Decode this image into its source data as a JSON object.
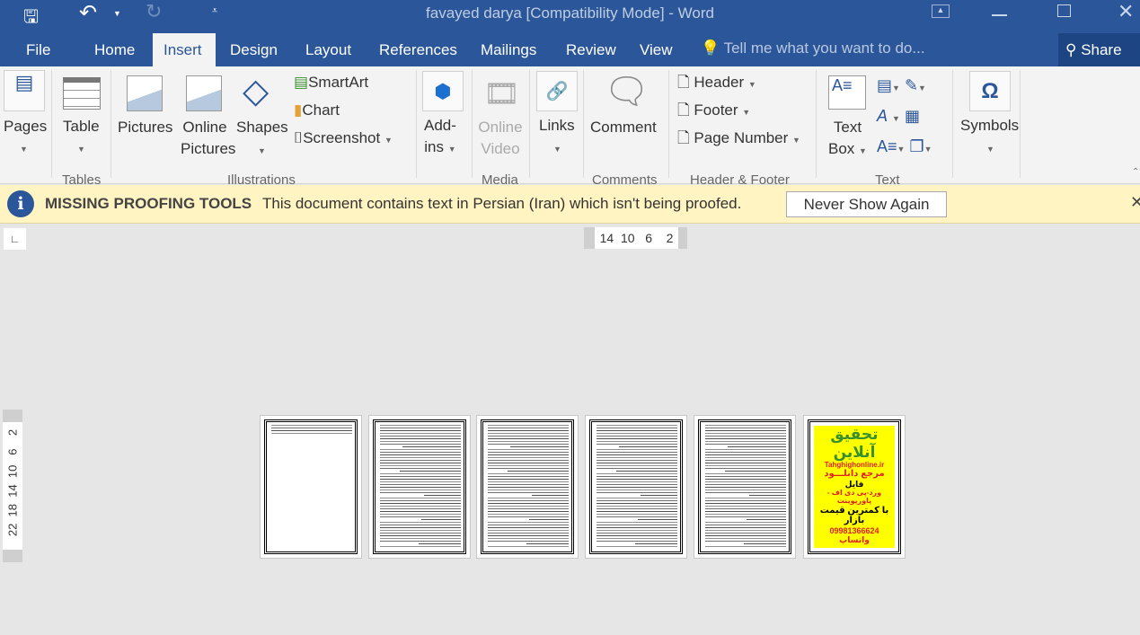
{
  "window": {
    "title": "favayed darya [Compatibility Mode] - Word"
  },
  "tabs": [
    {
      "label": "File"
    },
    {
      "label": "Home"
    },
    {
      "label": "Insert",
      "active": true
    },
    {
      "label": "Design"
    },
    {
      "label": "Layout"
    },
    {
      "label": "References"
    },
    {
      "label": "Mailings"
    },
    {
      "label": "Review"
    },
    {
      "label": "View"
    }
  ],
  "tell_me": {
    "placeholder": "Tell me what you want to do..."
  },
  "share": {
    "label": "Share"
  },
  "ribbon": {
    "pages": "Pages",
    "table": "Table",
    "tables_group": "Tables",
    "pictures": "Pictures",
    "online_pictures_1": "Online",
    "online_pictures_2": "Pictures",
    "shapes": "Shapes",
    "smartart": "SmartArt",
    "chart": "Chart",
    "screenshot": "Screenshot",
    "illustrations_group": "Illustrations",
    "addins_1": "Add-",
    "addins_2": "ins",
    "online_video_1": "Online",
    "online_video_2": "Video",
    "media_group": "Media",
    "links": "Links",
    "comment": "Comment",
    "comments_group": "Comments",
    "header": "Header",
    "footer": "Footer",
    "page_number": "Page Number",
    "header_footer_group": "Header & Footer",
    "text_box_1": "Text",
    "text_box_2": "Box",
    "text_group": "Text",
    "symbols": "Symbols"
  },
  "message_bar": {
    "title": "MISSING PROOFING TOOLS",
    "text": "This document contains text in Persian (Iran) which isn't being proofed.",
    "button": "Never Show Again"
  },
  "ruler": {
    "top": "14  10   6    2",
    "left": "22  18  14  10   6    2"
  },
  "ad_page": {
    "heading": "تحقیق آنلاین",
    "site": "Tahghighonline.ir",
    "l1": "مرجع دانلـــود",
    "l2": "فایل",
    "l3": "ورد-پی دی اف - پاورپوینت",
    "l4": "با کمترین قیمت بازار",
    "phone": "09981366624 واتساپ"
  },
  "colors": {
    "brand": "#2b579a",
    "ribbon": "#f3f3f3",
    "message_bar": "#fff4c2",
    "ad_bg": "#ffff00",
    "ad_green": "#3a8f2e",
    "ad_red": "#e02020"
  }
}
